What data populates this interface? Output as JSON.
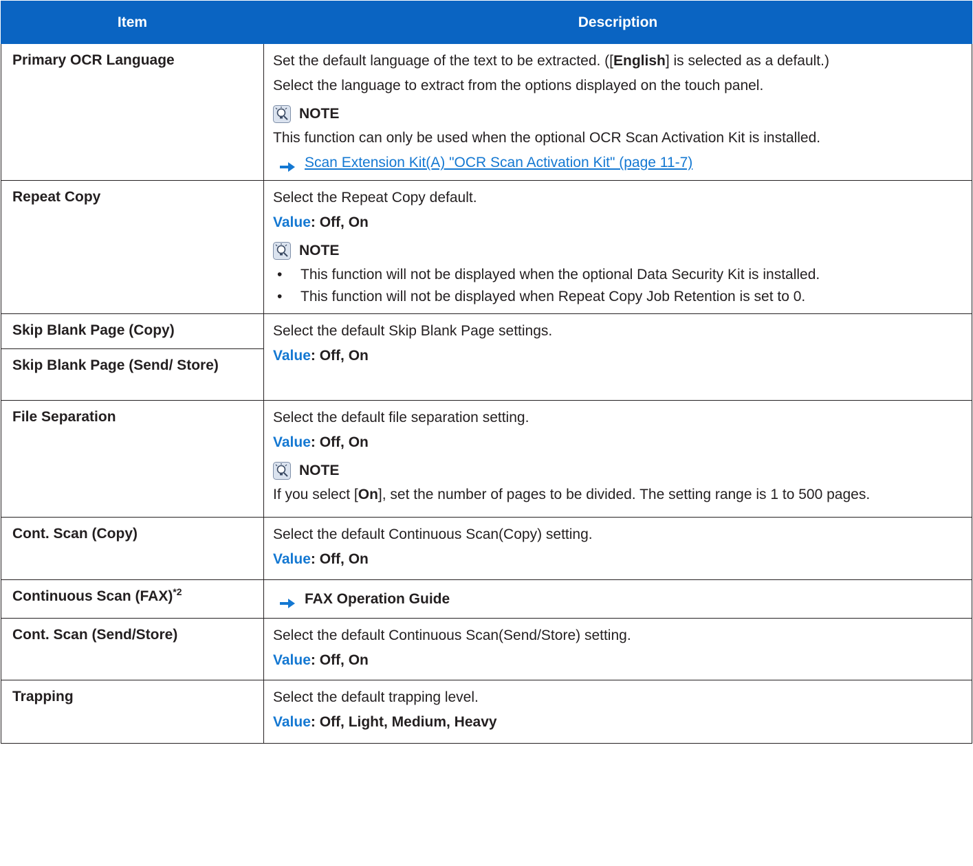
{
  "header": {
    "item": "Item",
    "description": "Description"
  },
  "rows": {
    "ocr": {
      "item": "Primary OCR Language",
      "desc_a": "Set the default language of the text to be extracted. ([",
      "desc_b": "English",
      "desc_c": "] is selected as a default.)",
      "desc2": "Select the language to extract from the options displayed on the touch panel.",
      "note_title": "NOTE",
      "note_text": "This function can only be used when the optional OCR Scan Activation Kit is installed.",
      "link": "Scan Extension Kit(A) \"OCR Scan Activation Kit\" (page 11-7)"
    },
    "repeat": {
      "item": "Repeat Copy",
      "desc": "Select the Repeat Copy default.",
      "value_label": "Value",
      "value": ": Off, On",
      "note_title": "NOTE",
      "bullet": "•",
      "bullets": [
        "This function will not be displayed when the optional Data Security Kit is installed.",
        "This function will not be displayed when Repeat Copy Job Retention is set to 0."
      ]
    },
    "skip": {
      "item1": "Skip Blank Page (Copy)",
      "item2": "Skip Blank Page (Send/ Store)",
      "desc": "Select the default Skip Blank Page settings.",
      "value_label": "Value",
      "value": ": Off, On"
    },
    "file": {
      "item": "File Separation",
      "desc": "Select the default file separation setting.",
      "value_label": "Value",
      "value": ": Off, On",
      "note_title": "NOTE",
      "note_a": "If you select [",
      "note_b": "On",
      "note_c": "], set the number of pages to be divided. The setting range is 1 to 500 pages."
    },
    "cont_copy": {
      "item": "Cont. Scan (Copy)",
      "desc": "Select the default Continuous Scan(Copy) setting.",
      "value_label": "Value",
      "value": ": Off, On"
    },
    "cont_fax": {
      "item": "Continuous Scan (FAX)",
      "item_sup": "*2",
      "ref": "FAX Operation Guide"
    },
    "cont_send": {
      "item": "Cont. Scan (Send/Store)",
      "desc": "Select the default Continuous Scan(Send/Store) setting.",
      "value_label": "Value",
      "value": ": Off, On"
    },
    "trapping": {
      "item": "Trapping",
      "desc": "Select the default trapping level.",
      "value_label": "Value",
      "value": ": Off, Light, Medium, Heavy"
    }
  },
  "colors": {
    "header_bg": "#0a64c2",
    "accent": "#1478d2",
    "text": "#231f20"
  },
  "icons": {
    "note": "note-lightbulb-icon",
    "arrow": "arrow-right-icon"
  }
}
